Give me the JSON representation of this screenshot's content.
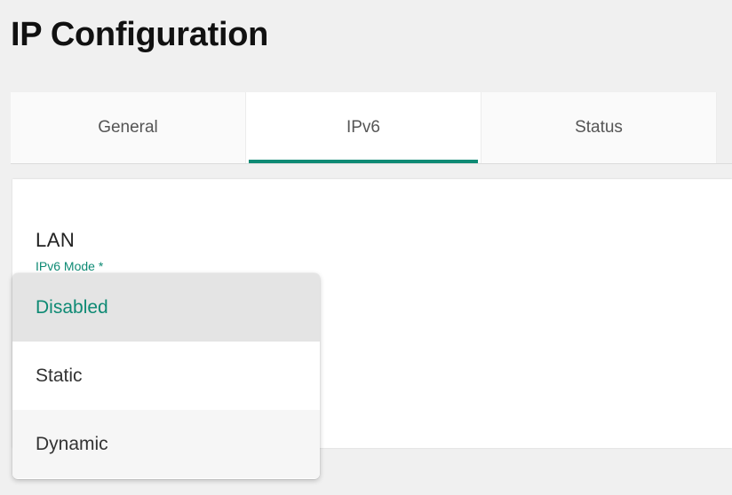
{
  "page": {
    "title": "IP Configuration"
  },
  "tabs": [
    {
      "label": "General",
      "active": false
    },
    {
      "label": "IPv6",
      "active": true
    },
    {
      "label": "Status",
      "active": false
    }
  ],
  "section": {
    "title": "LAN",
    "field_label": "IPv6 Mode *"
  },
  "dropdown": {
    "selected": "Disabled",
    "options": [
      {
        "label": "Disabled"
      },
      {
        "label": "Static"
      },
      {
        "label": "Dynamic"
      }
    ]
  },
  "colors": {
    "accent": "#0e8a74",
    "background": "#f0f0f0",
    "selected_option_bg": "#e4e4e4"
  }
}
